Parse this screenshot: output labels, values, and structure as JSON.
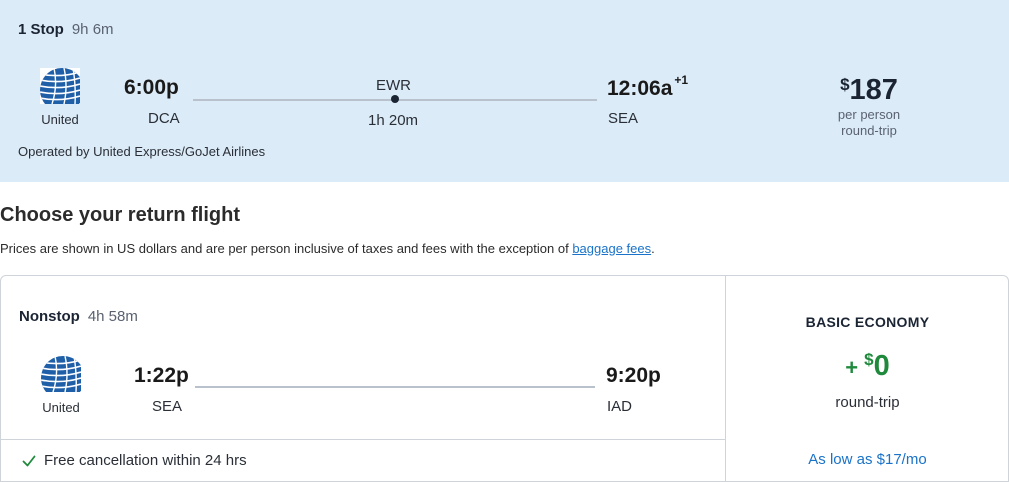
{
  "outbound": {
    "stops": "1 Stop",
    "duration": "9h 6m",
    "airline": "United",
    "depart_time": "6:00p",
    "depart_code": "DCA",
    "layover_code": "EWR",
    "layover_duration": "1h 20m",
    "arrive_time": "12:06a",
    "arrive_day_offset": "+1",
    "arrive_code": "SEA",
    "price_currency": "$",
    "price_value": "187",
    "price_line1": "per person",
    "price_line2": "round-trip",
    "operated_by": "Operated by United Express/GoJet Airlines"
  },
  "return_section": {
    "heading": "Choose your return flight",
    "notice_text": "Prices are shown in US dollars and are per person inclusive of taxes and fees with the exception of ",
    "notice_link": "baggage fees",
    "notice_end": "."
  },
  "return_flight": {
    "stops": "Nonstop",
    "duration": "4h 58m",
    "airline": "United",
    "depart_time": "1:22p",
    "depart_code": "SEA",
    "arrive_time": "9:20p",
    "arrive_code": "IAD",
    "cancellation": "Free cancellation within 24 hrs",
    "cabin": "BASIC ECONOMY",
    "price_prefix": "+",
    "price_currency": "$",
    "price_value": "0",
    "price_sub": "round-trip",
    "monthly": "As low as $17/mo"
  },
  "colors": {
    "selected_bg": "#dcebf8",
    "brand_blue": "#1a73c9",
    "price_green": "#1f8a3c",
    "united_blue": "#1f5fa8"
  },
  "icons": [
    "united-globe-logo",
    "check-icon"
  ]
}
